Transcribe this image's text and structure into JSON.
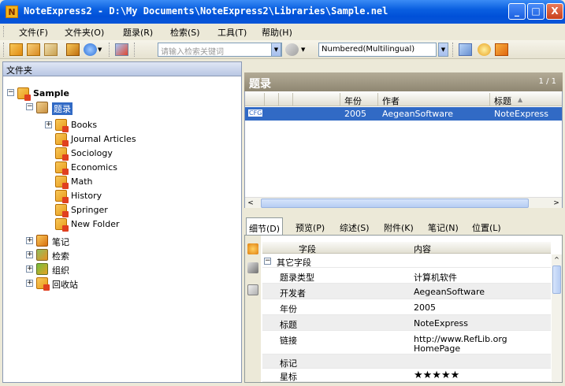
{
  "window": {
    "title": "NoteExpress2 - D:\\My Documents\\NoteExpress2\\Libraries\\Sample.nel",
    "app_icon": "N",
    "minimize": "_",
    "maximize": "□",
    "close": "X"
  },
  "menu": [
    "文件(F)",
    "文件夹(O)",
    "题录(R)",
    "检索(S)",
    "工具(T)",
    "帮助(H)"
  ],
  "toolbar": {
    "search_placeholder": "请输入检索关键词",
    "output_style": "Numbered(Multilingual)"
  },
  "folders": {
    "header": "文件夹",
    "root": "Sample",
    "references_node": "题录",
    "children": [
      "Books",
      "Journal Articles",
      "Sociology",
      "Economics",
      "Math",
      "History",
      "Springer",
      "New Folder"
    ],
    "other_nodes": [
      "笔记",
      "检索",
      "组织",
      "回收站"
    ]
  },
  "references": {
    "title": "题录",
    "page": "1 / 1",
    "columns": {
      "year": "年份",
      "author": "作者",
      "title": "标题"
    },
    "rows": [
      {
        "type_icon": "CFG",
        "year": "2005",
        "author": "AegeanSoftware",
        "title": "NoteExpress"
      }
    ]
  },
  "tabs": [
    "细节(D)",
    "预览(P)",
    "综述(S)",
    "附件(K)",
    "笔记(N)",
    "位置(L)"
  ],
  "detail": {
    "col_field": "字段",
    "col_value": "内容",
    "group": "其它字段",
    "fields": [
      {
        "label": "题录类型",
        "value": "计算机软件"
      },
      {
        "label": "开发者",
        "value": "AegeanSoftware"
      },
      {
        "label": "年份",
        "value": "2005"
      },
      {
        "label": "标题",
        "value": "NoteExpress"
      },
      {
        "label": "链接",
        "value": "http://www.RefLib.org",
        "value2": "HomePage"
      },
      {
        "label": "标记",
        "value": ""
      },
      {
        "label": "星标",
        "value": "★★★★★"
      }
    ]
  }
}
